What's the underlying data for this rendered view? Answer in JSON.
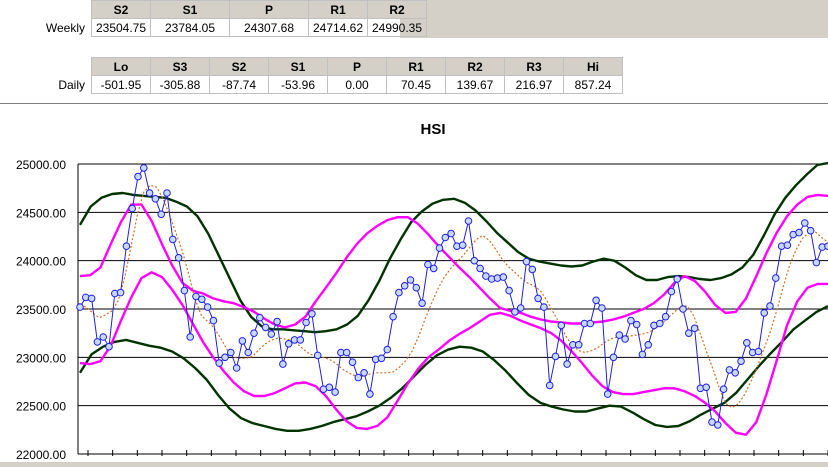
{
  "weekly": {
    "row_label": "Weekly",
    "headers": [
      "S2",
      "S1",
      "P",
      "R1",
      "R2"
    ],
    "values": [
      "23504.75",
      "23784.05",
      "24307.68",
      "24714.62",
      "24990.35"
    ]
  },
  "daily": {
    "row_label": "Daily",
    "headers": [
      "Lo",
      "S3",
      "S2",
      "S1",
      "P",
      "R1",
      "R2",
      "R3",
      "Hi"
    ],
    "values": [
      "-501.95",
      "-305.88",
      "-87.74",
      "-53.96",
      "0.00",
      "70.45",
      "139.67",
      "216.97",
      "857.24"
    ]
  },
  "colors": {
    "price": "#2020e0",
    "price_marker_fill": "#c8d8ff",
    "ma": "#d07020",
    "inner_band": "#ff00ff",
    "outer_band": "#003300"
  },
  "chart_data": {
    "type": "line",
    "title": "HSI",
    "ylim": [
      22000,
      25000
    ],
    "y_ticks": [
      "22000.00",
      "22500.00",
      "23000.00",
      "23500.00",
      "24000.00",
      "24500.00",
      "25000.00"
    ],
    "grid": true,
    "x_tick_count": 31,
    "series": [
      {
        "role": "price",
        "values": [
          23520,
          23620,
          23610,
          23160,
          23210,
          23110,
          23660,
          23670,
          24150,
          24540,
          24870,
          24960,
          24700,
          24640,
          24480,
          24700,
          24220,
          24030,
          23690,
          23210,
          23630,
          23600,
          23520,
          23380,
          22940,
          23000,
          23050,
          22890,
          23170,
          23050,
          23250,
          23410,
          23310,
          23240,
          23370,
          22930,
          23140,
          23180,
          23180,
          23360,
          23450,
          23020,
          22670,
          22690,
          22640,
          23050,
          23050,
          22950,
          22790,
          22840,
          22620,
          22980,
          22990,
          23080,
          23420,
          23670,
          23740,
          23800,
          23720,
          23560,
          23960,
          23920,
          24130,
          24240,
          24280,
          24150,
          24160,
          24410,
          24000,
          23920,
          23840,
          23810,
          23820,
          23830,
          23690,
          23470,
          23510,
          23990,
          23910,
          23610,
          23520,
          22710,
          23010,
          23330,
          22930,
          23130,
          23130,
          23350,
          23350,
          23590,
          23510,
          22620,
          23000,
          23230,
          23190,
          23380,
          23340,
          23030,
          23130,
          23330,
          23350,
          23420,
          23680,
          23810,
          23500,
          23250,
          23300,
          22680,
          22690,
          22330,
          22300,
          22670,
          22870,
          22840,
          22960,
          23150,
          23050,
          23060,
          23460,
          23530,
          23820,
          24150,
          24160,
          24270,
          24290,
          24390,
          24310,
          23980,
          24140,
          24150
        ]
      },
      {
        "role": "moving-average",
        "values": [
          23540,
          23520,
          23460,
          23410,
          23440,
          23480,
          23590,
          23830,
          24150,
          24480,
          24710,
          24780,
          24760,
          24640,
          24470,
          24290,
          24100,
          23860,
          23600,
          23430,
          23370,
          23300,
          23200,
          23080,
          23000,
          22990,
          22990,
          23010,
          23080,
          23140,
          23180,
          23200,
          23190,
          23180,
          23140,
          23080,
          23030,
          23020,
          23000,
          22980,
          22940,
          22880,
          22840,
          22810,
          22800,
          22820,
          22840,
          22840,
          22840,
          22850,
          22900,
          22970,
          23070,
          23220,
          23400,
          23560,
          23710,
          23830,
          23920,
          23990,
          24060,
          24140,
          24220,
          24260,
          24210,
          24120,
          24020,
          23940,
          23880,
          23820,
          23770,
          23740,
          23690,
          23590,
          23470,
          23350,
          23220,
          23120,
          23070,
          23050,
          23070,
          23100,
          23150,
          23190,
          23210,
          23220,
          23220,
          23230,
          23240,
          23260,
          23300,
          23350,
          23410,
          23470,
          23530,
          23530,
          23430,
          23250,
          23060,
          22880,
          22680,
          22520,
          22480,
          22520,
          22620,
          22760,
          22910,
          23090,
          23270,
          23490,
          23730,
          23950,
          24110,
          24230,
          24290,
          24300,
          24240,
          24190
        ]
      },
      {
        "role": "upper-inner",
        "values": [
          23840,
          23850,
          23930,
          24170,
          24400,
          24580,
          24580,
          24410,
          24170,
          23950,
          23770,
          23690,
          23660,
          23610,
          23580,
          23560,
          23520,
          23470,
          23400,
          23340,
          23310,
          23340,
          23420,
          23580,
          23720,
          23870,
          24030,
          24170,
          24280,
          24360,
          24420,
          24450,
          24450,
          24380,
          24270,
          24150,
          24040,
          23930,
          23830,
          23720,
          23610,
          23510,
          23480,
          23460,
          23420,
          23390,
          23370,
          23360,
          23350,
          23350,
          23360,
          23370,
          23390,
          23420,
          23460,
          23500,
          23560,
          23650,
          23770,
          23840,
          23790,
          23680,
          23540,
          23460,
          23470,
          23610,
          23840,
          24080,
          24290,
          24460,
          24580,
          24660,
          24680,
          24670
        ]
      },
      {
        "role": "lower-inner",
        "values": [
          22940,
          22930,
          22960,
          23120,
          23380,
          23620,
          23820,
          23880,
          23830,
          23700,
          23540,
          23350,
          23160,
          23000,
          22860,
          22740,
          22650,
          22600,
          22600,
          22630,
          22680,
          22730,
          22740,
          22700,
          22600,
          22460,
          22340,
          22270,
          22260,
          22290,
          22380,
          22550,
          22730,
          22880,
          23000,
          23080,
          23170,
          23240,
          23300,
          23370,
          23440,
          23460,
          23430,
          23380,
          23340,
          23300,
          23250,
          23170,
          23060,
          22940,
          22810,
          22700,
          22640,
          22620,
          22620,
          22640,
          22660,
          22680,
          22680,
          22650,
          22600,
          22530,
          22440,
          22320,
          22220,
          22200,
          22330,
          22620,
          22970,
          23330,
          23580,
          23720,
          23760,
          23760
        ]
      },
      {
        "role": "upper-outer",
        "values": [
          24370,
          24560,
          24650,
          24690,
          24700,
          24680,
          24670,
          24660,
          24650,
          24610,
          24560,
          24460,
          24280,
          24050,
          23820,
          23590,
          23420,
          23320,
          23290,
          23290,
          23280,
          23270,
          23260,
          23270,
          23290,
          23340,
          23430,
          23590,
          23790,
          24020,
          24220,
          24400,
          24510,
          24590,
          24630,
          24640,
          24600,
          24520,
          24410,
          24290,
          24190,
          24090,
          24020,
          23990,
          23970,
          23950,
          23940,
          23950,
          23990,
          24020,
          24000,
          23930,
          23850,
          23800,
          23800,
          23830,
          23840,
          23830,
          23810,
          23800,
          23820,
          23860,
          23930,
          24060,
          24260,
          24480,
          24650,
          24780,
          24890,
          24990,
          25010
        ]
      },
      {
        "role": "lower-outer",
        "values": [
          22840,
          23030,
          23110,
          23160,
          23180,
          23150,
          23120,
          23100,
          23060,
          22990,
          22890,
          22770,
          22610,
          22470,
          22370,
          22320,
          22290,
          22260,
          22240,
          22240,
          22260,
          22290,
          22330,
          22360,
          22390,
          22440,
          22500,
          22580,
          22680,
          22800,
          22920,
          23020,
          23080,
          23110,
          23100,
          23060,
          22970,
          22860,
          22730,
          22610,
          22530,
          22490,
          22460,
          22440,
          22440,
          22470,
          22500,
          22490,
          22430,
          22360,
          22300,
          22280,
          22290,
          22340,
          22410,
          22470,
          22530,
          22630,
          22770,
          22910,
          23040,
          23160,
          23290,
          23380,
          23470,
          23530
        ]
      }
    ]
  }
}
